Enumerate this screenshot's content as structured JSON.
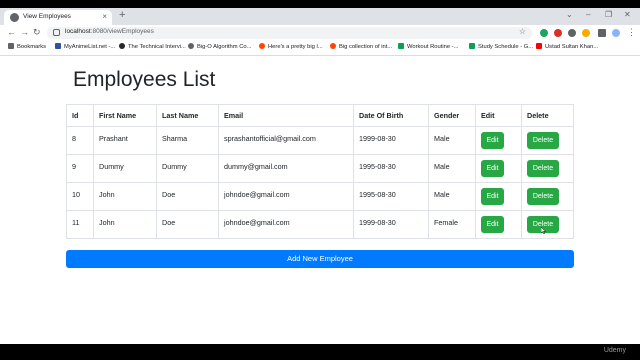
{
  "browser": {
    "tab_title": "View Employees",
    "tab_close": "×",
    "new_tab": "+",
    "url_host": "localhost",
    "url_path": ":8080/viewEmployees",
    "bookmarks": [
      {
        "label": "Bookmarks",
        "color": "#5f6368"
      },
      {
        "label": "MyAnimeList.net -...",
        "color": "#2e51a2"
      },
      {
        "label": "The Technical Intervi...",
        "color": "#24292e"
      },
      {
        "label": "Big-O Algorithm Co...",
        "color": "#5f6368"
      },
      {
        "label": "Here's a pretty big l...",
        "color": "#ff4500"
      },
      {
        "label": "Big collection of int...",
        "color": "#ff4500"
      },
      {
        "label": "Workout Routine -...",
        "color": "#0f9d58"
      },
      {
        "label": "Study Schedule - G...",
        "color": "#0f9d58"
      },
      {
        "label": "Ustad Sultan Khan...",
        "color": "#ff0000"
      }
    ]
  },
  "page": {
    "title": "Employees List",
    "columns": [
      "Id",
      "First Name",
      "Last Name",
      "Email",
      "Date Of Birth",
      "Gender",
      "Edit",
      "Delete"
    ],
    "rows": [
      {
        "id": "8",
        "first": "Prashant",
        "last": "Sharma",
        "email": "sprashantofficial@gmail.com",
        "dob": "1999-08-30",
        "gender": "Male"
      },
      {
        "id": "9",
        "first": "Dummy",
        "last": "Dummy",
        "email": "dummy@gmail.com",
        "dob": "1995-08-30",
        "gender": "Male"
      },
      {
        "id": "10",
        "first": "John",
        "last": "Doe",
        "email": "johndoe@gmail.com",
        "dob": "1995-08-30",
        "gender": "Male"
      },
      {
        "id": "11",
        "first": "John",
        "last": "Doe",
        "email": "johndoe@gmail.com",
        "dob": "1999-08-30",
        "gender": "Female"
      }
    ],
    "edit_label": "Edit",
    "delete_label": "Delete",
    "add_label": "Add New Employee"
  },
  "watermark": "Udemy",
  "colors": {
    "success": "#28a745",
    "primary": "#007bff"
  }
}
